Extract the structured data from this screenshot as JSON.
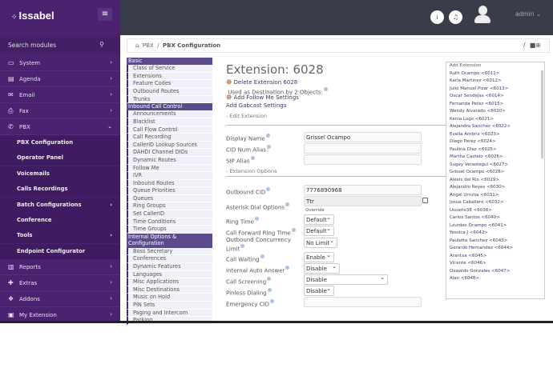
{
  "app": {
    "logo": "Issabel",
    "menu_icon": "hamburger-icon"
  },
  "sidebar": {
    "search": "Search modules",
    "items": [
      {
        "label": "System",
        "icon": "laptop-icon"
      },
      {
        "label": "Agenda",
        "icon": "book-icon"
      },
      {
        "label": "Email",
        "icon": "envelope-icon"
      },
      {
        "label": "Fax",
        "icon": "printer-icon"
      },
      {
        "label": "PBX",
        "icon": "phone-icon"
      }
    ],
    "pbx_sub": [
      {
        "label": "PBX Configuration"
      },
      {
        "label": "Operator Panel"
      },
      {
        "label": "Voicemails"
      },
      {
        "label": "Calls Recordings"
      },
      {
        "label": "Batch Configurations",
        "chev": true
      },
      {
        "label": "Conference"
      },
      {
        "label": "Tools",
        "chev": true
      },
      {
        "label": "Endpoint Configurator"
      }
    ],
    "items2": [
      {
        "label": "Reports",
        "icon": "chart-icon"
      },
      {
        "label": "Extras",
        "icon": "plus-icon"
      },
      {
        "label": "Addons",
        "icon": "cubes-icon"
      },
      {
        "label": "My Extension",
        "icon": "id-card-icon"
      }
    ]
  },
  "topbar": {
    "user": "admin"
  },
  "breadcrumb": {
    "root": "PBX",
    "current": "PBX Configuration",
    "sep": "/"
  },
  "leftmenu": [
    {
      "h": "Basic"
    },
    "Class of Service",
    "Extensions",
    "Feature Codes",
    "Outbound Routes",
    "Trunks",
    {
      "h": "Inbound Call Control"
    },
    "Announcements",
    "Blacklist",
    "Call Flow Control",
    "Call Recording",
    "CallerID Lookup Sources",
    "DAHDI Channel DIDs",
    "Dynamic Routes",
    "Follow Me",
    "IVR",
    "Inbound Routes",
    "Queue Priorities",
    "Queues",
    "Ring Groups",
    "Set CallerID",
    "Time Conditions",
    "Time Groups",
    {
      "h": "Internal Options & Configuration"
    },
    "Boss Secretary",
    "Conferences",
    "Dynamic Features",
    "Languages",
    "Misc Applications",
    "Misc Destinations",
    "Music on Hold",
    "PIN Sets",
    "Paging and Intercom",
    "Parking"
  ],
  "form": {
    "title": "Extension: 6028",
    "delete": "Delete Extension 6028",
    "used": "Used as Destination by 2 Objects:",
    "follow": "Add Follow Me Settings",
    "gabcast": "Add Gabcast Settings",
    "edit_section": "- Edit Extension",
    "ext_options": "- Extension Options",
    "display_name_label": "Display Name",
    "display_name": "Grissel Ocampo",
    "cid_label": "CID Num Alias",
    "sip_label": "SIP Alias",
    "outbound_cid_label": "Outbound CID",
    "outbound_cid": "7776890968",
    "dial_label": "Asterisk Dial Options",
    "dial": "Ttr",
    "override": "Override",
    "ring_label": "Ring Time",
    "ring": "Default",
    "cf_label": "Call Forward Ring Time",
    "cf": "Default",
    "conc_label": "Outbound Concurrency Limit",
    "conc": "No Limit",
    "wait_label": "Call Waiting",
    "wait": "Enable",
    "auto_label": "Internal Auto Answer",
    "auto": "Disable",
    "screen_label": "Call Screening",
    "screen": "Disable",
    "pinless_label": "Pinless Dialing",
    "pinless": "Disable",
    "emerg_label": "Emergency CID"
  },
  "extensions": [
    "Add Extension",
    "Ruth Ocampo <6011>",
    "Karla Martinez <6012>",
    "Julio Manuel Pizar <6013>",
    "Oscar Sendejas <6014>",
    "Fernanda Perez <6015>",
    "Wendy Alvarado <6020>",
    "Kenia Lugo <6021>",
    "Alejandra Sanchez <6022>",
    "Evelia Ambriz <6023>",
    "Diego Perez <6024>",
    "Paulina Diaz <6025>",
    "Martha Castelo <6026>",
    "Sugey Verastegui <6027>",
    "Grissel Ocampo <6028>",
    "Alexis del Rio <6029>",
    "Alejandro Reyes <6030>",
    "Angel Urrutia <6031>",
    "Josue Caballero <6032>",
    "Usuario38 <6038>",
    "Carlos Santos <6040>",
    "Lourdes Ocampo <6041>",
    "Yessica J <6042>",
    "Paulette Sanchez <6043>",
    "Gerardo Hernandez <6044>",
    "Arantxa <6045>",
    "Vicente <6046>",
    "Oswaldo Gonzales <6047>",
    "Alan <6048>"
  ]
}
